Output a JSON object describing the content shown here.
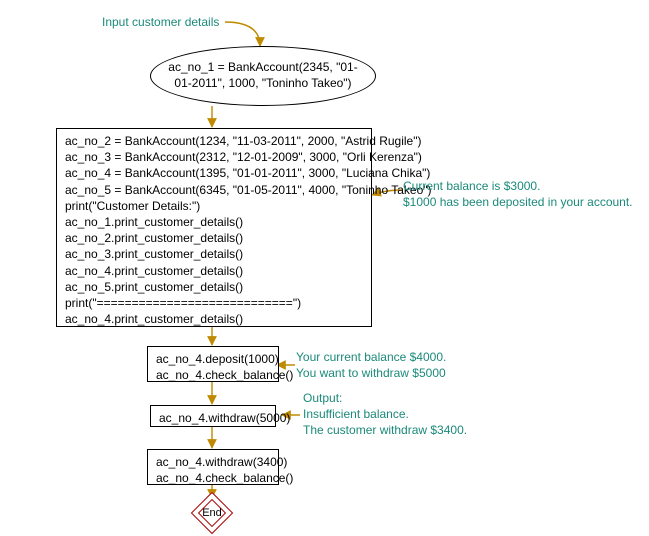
{
  "top_note": "Input customer details",
  "node_ellipse": "ac_no_1 = BankAccount(2345, \"01-01-2011\", 1000, \"Toninho Takeo\")",
  "node_big": "ac_no_2 = BankAccount(1234, \"11-03-2011\", 2000, \"Astrid Rugile\")\nac_no_3 = BankAccount(2312, \"12-01-2009\", 3000, \"Orli Kerenza\")\nac_no_4 = BankAccount(1395, \"01-01-2011\", 3000, \"Luciana Chika\")\nac_no_5 = BankAccount(6345, \"01-05-2011\", 4000, \"Toninho Takeo\")\nprint(\"Customer Details:\")\nac_no_1.print_customer_details()\nac_no_2.print_customer_details()\nac_no_3.print_customer_details()\nac_no_4.print_customer_details()\nac_no_5.print_customer_details()\nprint(\"============================\")\nac_no_4.print_customer_details()",
  "node_deposit": "ac_no_4.deposit(1000)\nac_no_4.check_balance()",
  "node_withdraw1": "ac_no_4.withdraw(5000)",
  "node_withdraw2": "ac_no_4.withdraw(3400)\nac_no_4.check_balance()",
  "note_big": "Current balance is $3000.\n$1000 has been deposited in your account.",
  "note_deposit": "Your current balance $4000.\nYou want to withdraw $5000",
  "note_withdraw1": "Output:\nInsufficient balance.\nThe customer withdraw $3400.",
  "end_label": "End",
  "colors": {
    "teal": "#1b8a7a",
    "arrow": "#c08a00",
    "end_border": "#a00000"
  }
}
